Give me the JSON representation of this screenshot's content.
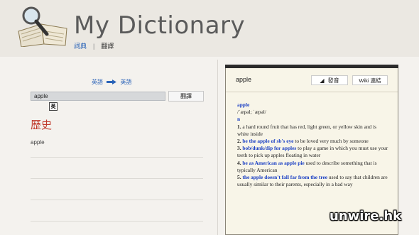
{
  "app": {
    "title": "My Dictionary"
  },
  "nav": {
    "dictionary": "詞典",
    "separator": "|",
    "translate": "翻譯"
  },
  "lang": {
    "from": "英語",
    "to": "英語"
  },
  "search": {
    "value": "apple",
    "button": "翻譯",
    "lang_badge": "英"
  },
  "history": {
    "title": "歷史",
    "items": [
      "apple",
      "",
      "",
      "",
      ""
    ]
  },
  "panel": {
    "word": "apple",
    "speak_label": "發音",
    "wiki_label": "Wiki 連結",
    "headword": "apple",
    "pronunciation": "/ˈæpəl; ˈæpəl/",
    "pos": "n",
    "senses": [
      {
        "num": "1.",
        "phrase": "",
        "text": "a hard round fruit that has red, light green, or yellow skin and is white inside"
      },
      {
        "num": "2.",
        "phrase": "be the apple of sb's eye",
        "text": " to be loved very much by someone"
      },
      {
        "num": "3.",
        "phrase": "bob/dunk/dip for apples",
        "text": " to play a game in which you must use your teeth to pick up apples floating in water"
      },
      {
        "num": "4.",
        "phrase": "be as American as apple pie",
        "text": " used to describe something that is typically American"
      },
      {
        "num": "5.",
        "phrase": "the apple doesn't fall far from the tree",
        "text": " used to say that children are usually similar to their parents, especially in a bad way"
      }
    ]
  },
  "watermark": "unwire.hk",
  "icons": {
    "logo": "book-magnifier-icon",
    "arrow": "arrow-right-icon",
    "speaker": "speaker-icon"
  }
}
